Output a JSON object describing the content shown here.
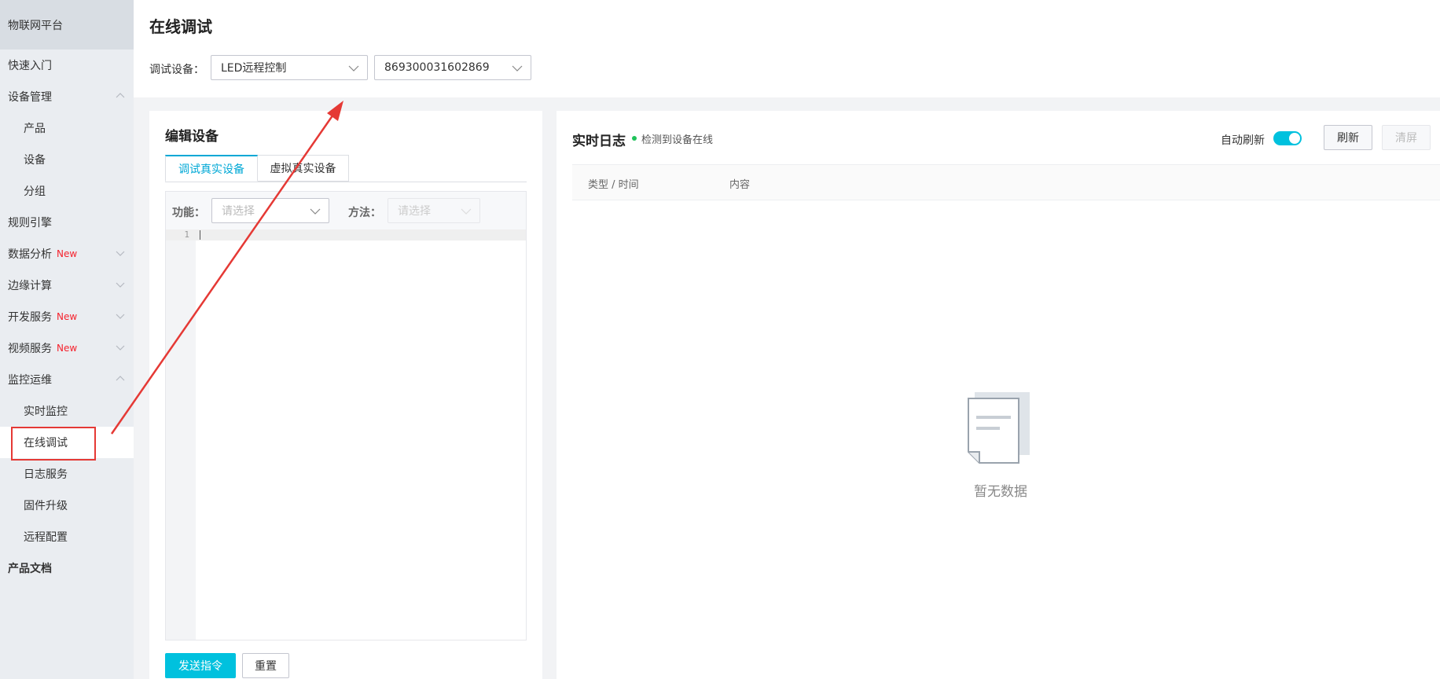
{
  "sidebar": {
    "brand": "物联网平台",
    "items": [
      {
        "label": "快速入门"
      },
      {
        "label": "设备管理"
      },
      {
        "label": "产品"
      },
      {
        "label": "设备"
      },
      {
        "label": "分组"
      },
      {
        "label": "规则引擎"
      },
      {
        "label": "数据分析",
        "badge": "New"
      },
      {
        "label": "边缘计算"
      },
      {
        "label": "开发服务",
        "badge": "New"
      },
      {
        "label": "视频服务",
        "badge": "New"
      },
      {
        "label": "监控运维"
      },
      {
        "label": "实时监控"
      },
      {
        "label": "在线调试"
      },
      {
        "label": "日志服务"
      },
      {
        "label": "固件升级"
      },
      {
        "label": "远程配置"
      },
      {
        "label": "产品文档"
      }
    ]
  },
  "header": {
    "title": "在线调试",
    "device_label": "调试设备：",
    "product_select": "LED远程控制",
    "device_select": "869300031602869"
  },
  "editor_panel": {
    "title": "编辑设备",
    "tabs": [
      {
        "label": "调试真实设备"
      },
      {
        "label": "虚拟真实设备"
      }
    ],
    "function_label": "功能：",
    "function_placeholder": "请选择",
    "method_label": "方法：",
    "method_placeholder": "请选择",
    "line_number": "1",
    "send_button": "发送指令",
    "reset_button": "重置"
  },
  "log_panel": {
    "title": "实时日志",
    "status": "检测到设备在线",
    "auto_refresh_label": "自动刷新",
    "auto_refresh_on": true,
    "refresh_button": "刷新",
    "clear_button": "清屏",
    "columns": [
      "类型 / 时间",
      "内容"
    ],
    "empty_text": "暂无数据"
  },
  "colors": {
    "accent": "#00c1de",
    "tab_active": "#00a8d6",
    "new_badge": "#f5222d",
    "online": "#1fc25a",
    "annotation": "#e53935"
  }
}
